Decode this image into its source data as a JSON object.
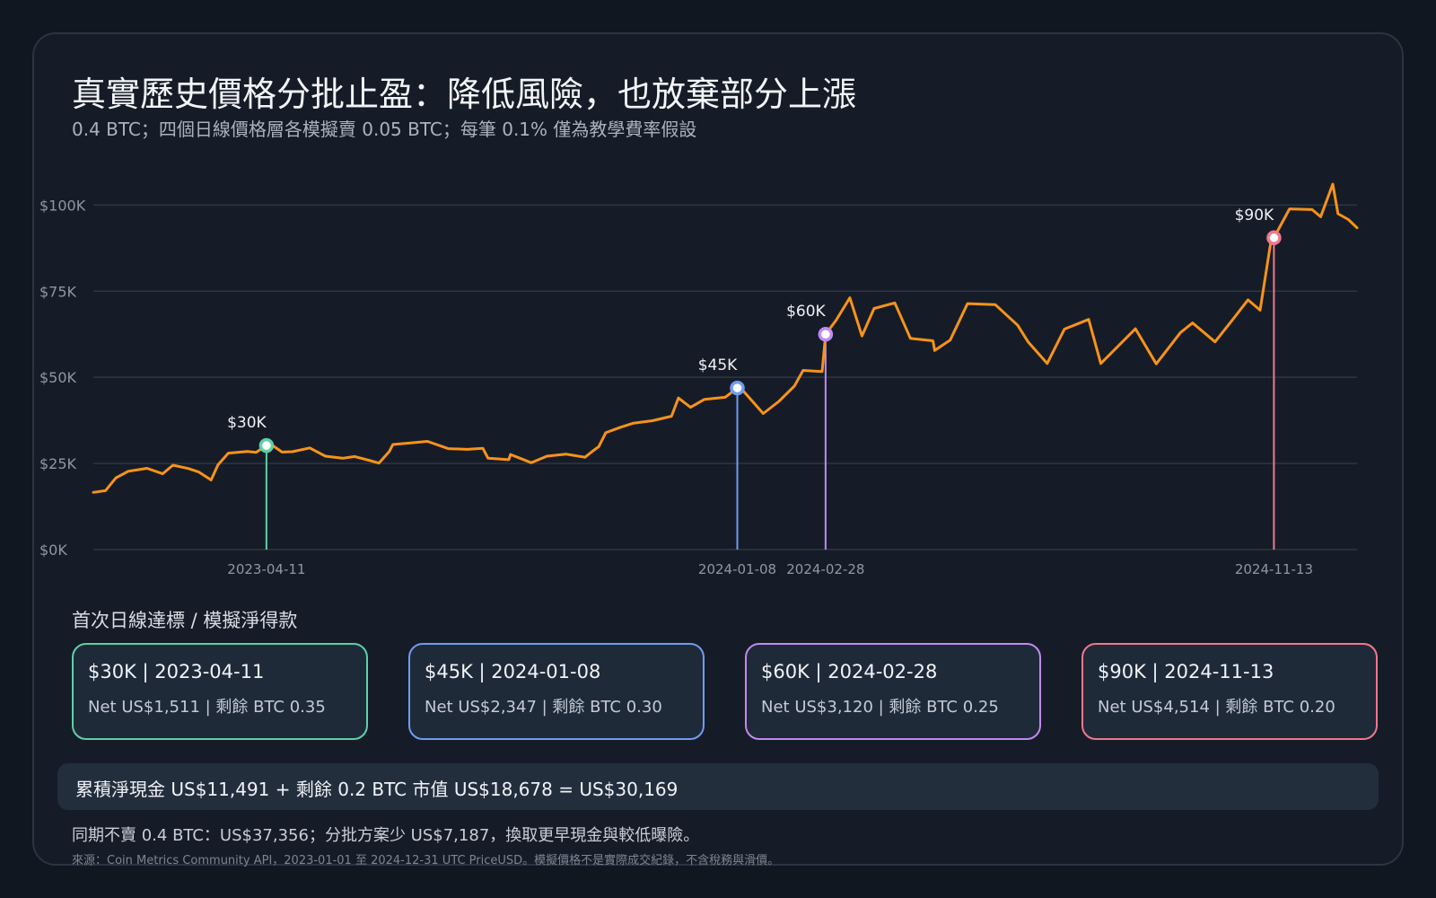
{
  "header": {
    "title": "真實歷史價格分批止盈：降低風險，也放棄部分上漲",
    "subtitle": "0.4 BTC；四個日線價格層各模擬賣 0.05 BTC；每筆 0.1% 僅為教學費率假設"
  },
  "colors": {
    "price_line": "#f7931a",
    "grid": "#2c3644",
    "tier_30k": "#5fd0a6",
    "tier_45k": "#6f9cf0",
    "tier_60k": "#c08af2",
    "tier_90k": "#f0788e"
  },
  "chart_data": {
    "type": "line",
    "x_range": [
      "2023-01-01",
      "2024-12-31"
    ],
    "ylim": [
      0,
      110000
    ],
    "y_ticks": [
      {
        "value": 0,
        "label": "$0K"
      },
      {
        "value": 25000,
        "label": "$25K"
      },
      {
        "value": 50000,
        "label": "$50K"
      },
      {
        "value": 75000,
        "label": "$75K"
      },
      {
        "value": 100000,
        "label": "$100K"
      }
    ],
    "x_ticks": [
      "2023-04-11",
      "2024-01-08",
      "2024-02-28",
      "2024-11-13"
    ],
    "grid": true,
    "series": [
      {
        "points": [
          [
            "2023-01-01",
            16600
          ],
          [
            "2023-01-08",
            17100
          ],
          [
            "2023-01-14",
            20800
          ],
          [
            "2023-01-21",
            22700
          ],
          [
            "2023-02-01",
            23600
          ],
          [
            "2023-02-10",
            22000
          ],
          [
            "2023-02-16",
            24500
          ],
          [
            "2023-02-25",
            23500
          ],
          [
            "2023-03-03",
            22500
          ],
          [
            "2023-03-10",
            20200
          ],
          [
            "2023-03-14",
            24600
          ],
          [
            "2023-03-20",
            28000
          ],
          [
            "2023-03-31",
            28500
          ],
          [
            "2023-04-05",
            28200
          ],
          [
            "2023-04-11",
            30200
          ],
          [
            "2023-04-14",
            30400
          ],
          [
            "2023-04-20",
            28300
          ],
          [
            "2023-04-26",
            28400
          ],
          [
            "2023-05-06",
            29500
          ],
          [
            "2023-05-15",
            27100
          ],
          [
            "2023-05-25",
            26500
          ],
          [
            "2023-06-01",
            27000
          ],
          [
            "2023-06-10",
            25800
          ],
          [
            "2023-06-15",
            25100
          ],
          [
            "2023-06-21",
            28500
          ],
          [
            "2023-06-23",
            30500
          ],
          [
            "2023-07-04",
            31000
          ],
          [
            "2023-07-13",
            31400
          ],
          [
            "2023-07-25",
            29300
          ],
          [
            "2023-08-05",
            29100
          ],
          [
            "2023-08-14",
            29400
          ],
          [
            "2023-08-17",
            26500
          ],
          [
            "2023-08-29",
            26100
          ],
          [
            "2023-08-30",
            27600
          ],
          [
            "2023-09-11",
            25200
          ],
          [
            "2023-09-20",
            27100
          ],
          [
            "2023-10-01",
            27700
          ],
          [
            "2023-10-12",
            26800
          ],
          [
            "2023-10-16",
            28400
          ],
          [
            "2023-10-20",
            29900
          ],
          [
            "2023-10-24",
            33900
          ],
          [
            "2023-11-01",
            35400
          ],
          [
            "2023-11-09",
            36700
          ],
          [
            "2023-11-20",
            37400
          ],
          [
            "2023-12-01",
            38700
          ],
          [
            "2023-12-05",
            44000
          ],
          [
            "2023-12-12",
            41300
          ],
          [
            "2023-12-20",
            43600
          ],
          [
            "2024-01-01",
            44200
          ],
          [
            "2024-01-08",
            46900
          ],
          [
            "2024-01-11",
            46300
          ],
          [
            "2024-01-23",
            39500
          ],
          [
            "2024-02-01",
            43000
          ],
          [
            "2024-02-10",
            47500
          ],
          [
            "2024-02-15",
            52000
          ],
          [
            "2024-02-26",
            51700
          ],
          [
            "2024-02-28",
            62500
          ],
          [
            "2024-03-05",
            66500
          ],
          [
            "2024-03-13",
            73100
          ],
          [
            "2024-03-20",
            62000
          ],
          [
            "2024-03-27",
            70000
          ],
          [
            "2024-04-08",
            71600
          ],
          [
            "2024-04-17",
            61300
          ],
          [
            "2024-04-30",
            60600
          ],
          [
            "2024-05-01",
            57800
          ],
          [
            "2024-05-10",
            60800
          ],
          [
            "2024-05-20",
            71400
          ],
          [
            "2024-06-05",
            71100
          ],
          [
            "2024-06-18",
            65100
          ],
          [
            "2024-06-24",
            60300
          ],
          [
            "2024-07-05",
            54000
          ],
          [
            "2024-07-15",
            64000
          ],
          [
            "2024-07-29",
            66800
          ],
          [
            "2024-08-05",
            54000
          ],
          [
            "2024-08-25",
            64100
          ],
          [
            "2024-09-06",
            53900
          ],
          [
            "2024-09-20",
            63000
          ],
          [
            "2024-09-27",
            65800
          ],
          [
            "2024-10-10",
            60300
          ],
          [
            "2024-10-21",
            67300
          ],
          [
            "2024-10-29",
            72500
          ],
          [
            "2024-11-05",
            69500
          ],
          [
            "2024-11-11",
            88700
          ],
          [
            "2024-11-13",
            90500
          ],
          [
            "2024-11-22",
            98900
          ],
          [
            "2024-12-05",
            98700
          ],
          [
            "2024-12-10",
            96600
          ],
          [
            "2024-12-17",
            106100
          ],
          [
            "2024-12-20",
            97500
          ],
          [
            "2024-12-26",
            95800
          ],
          [
            "2024-12-31",
            93400
          ]
        ]
      }
    ],
    "markers": [
      {
        "date": "2023-04-11",
        "price": 30200,
        "label": "$30K",
        "color_key": "tier_30k"
      },
      {
        "date": "2024-01-08",
        "price": 46900,
        "label": "$45K",
        "color_key": "tier_45k"
      },
      {
        "date": "2024-02-28",
        "price": 62500,
        "label": "$60K",
        "color_key": "tier_60k"
      },
      {
        "date": "2024-11-13",
        "price": 90500,
        "label": "$90K",
        "color_key": "tier_90k"
      }
    ]
  },
  "milestones": {
    "title": "首次日線達標 / 模擬淨得款",
    "items": [
      {
        "heading": "$30K | 2023-04-11",
        "detail": "Net US$1,511 | 剩餘 BTC 0.35"
      },
      {
        "heading": "$45K | 2024-01-08",
        "detail": "Net US$2,347 | 剩餘 BTC 0.30"
      },
      {
        "heading": "$60K | 2024-02-28",
        "detail": "Net US$3,120 | 剩餘 BTC 0.25"
      },
      {
        "heading": "$90K | 2024-11-13",
        "detail": "Net US$4,514 | 剩餘 BTC 0.20"
      }
    ]
  },
  "summary": "累積淨現金 US$11,491 + 剩餘 0.2 BTC 市值 US$18,678 = US$30,169",
  "comparison": "同期不賣 0.4 BTC：US$37,356；分批方案少 US$7,187，換取更早現金與較低曝險。",
  "source": "來源：Coin Metrics Community API，2023-01-01 至 2024-12-31 UTC PriceUSD。模擬價格不是實際成交紀錄，不含稅務與滑價。"
}
